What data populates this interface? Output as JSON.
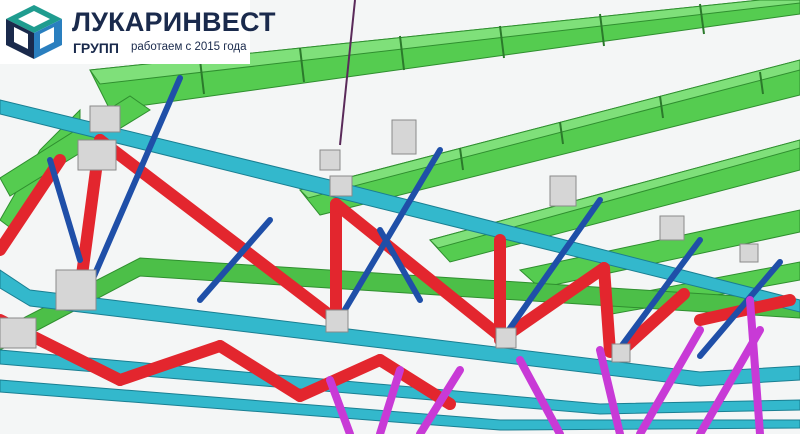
{
  "logo": {
    "company_name": "ЛУКАРИНВЕСТ",
    "group_label": "ГРУПП",
    "tagline": "работаем с 2015 года",
    "mark_icon": "cube-logo-icon"
  },
  "scene": {
    "subject": "3D model of steel roof truss structure",
    "colors": {
      "roof_beams": "#4cc94a",
      "chords": "#2fb3c8",
      "diagonals_red": "#e3262e",
      "braces_blue": "#1f4fa8",
      "members_magenta": "#c83ad6",
      "plates": "#d9d9d9"
    }
  }
}
